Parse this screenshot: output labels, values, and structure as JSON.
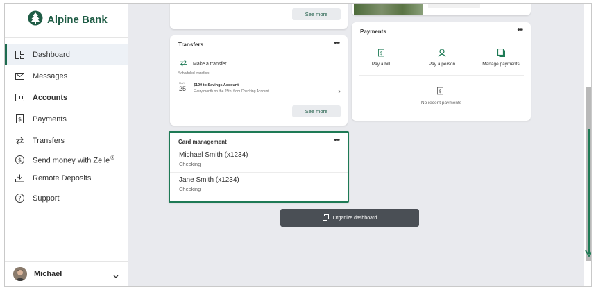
{
  "brand": {
    "name": "Alpine Bank",
    "icon": "tree-logo-icon"
  },
  "sidebar": {
    "items": [
      {
        "label": "Dashboard",
        "icon": "dashboard-icon",
        "active": true
      },
      {
        "label": "Messages",
        "icon": "mail-icon"
      },
      {
        "label": "Accounts",
        "icon": "accounts-icon",
        "bold": true
      },
      {
        "label": "Payments",
        "icon": "dollar-doc-icon"
      },
      {
        "label": "Transfers",
        "icon": "transfer-arrows-icon"
      },
      {
        "label": "Send money with Zelle",
        "sup": "®",
        "icon": "dollar-circle-icon"
      },
      {
        "label": "Remote Deposits",
        "icon": "download-tray-icon"
      },
      {
        "label": "Support",
        "icon": "help-circle-icon"
      }
    ]
  },
  "user": {
    "name": "Michael"
  },
  "top_card": {
    "see_more": "See more"
  },
  "transfers": {
    "title": "Transfers",
    "make_transfer": "Make a transfer",
    "scheduled_label": "Scheduled transfers",
    "scheduled": {
      "month": "MAY",
      "day": "25",
      "title": "$100 to Savings Account",
      "subtitle": "Every month on the 25th, from Checking Account"
    },
    "see_more": "See more"
  },
  "payments": {
    "title": "Payments",
    "actions": [
      {
        "label": "Pay a bill",
        "icon": "bill-icon"
      },
      {
        "label": "Pay a person",
        "icon": "person-icon"
      },
      {
        "label": "Manage payments",
        "icon": "manage-payments-icon"
      }
    ],
    "empty": "No recent payments"
  },
  "card_management": {
    "title": "Card management",
    "cards": [
      {
        "name": "Michael Smith (x1234)",
        "type": "Checking"
      },
      {
        "name": "Jane Smith (x1234)",
        "type": "Checking"
      }
    ]
  },
  "organize_button": "Organize dashboard",
  "colors": {
    "brand_green": "#1f5c45",
    "highlight_border": "#1e7a55",
    "scroll_arrow": "#1e7a55"
  }
}
